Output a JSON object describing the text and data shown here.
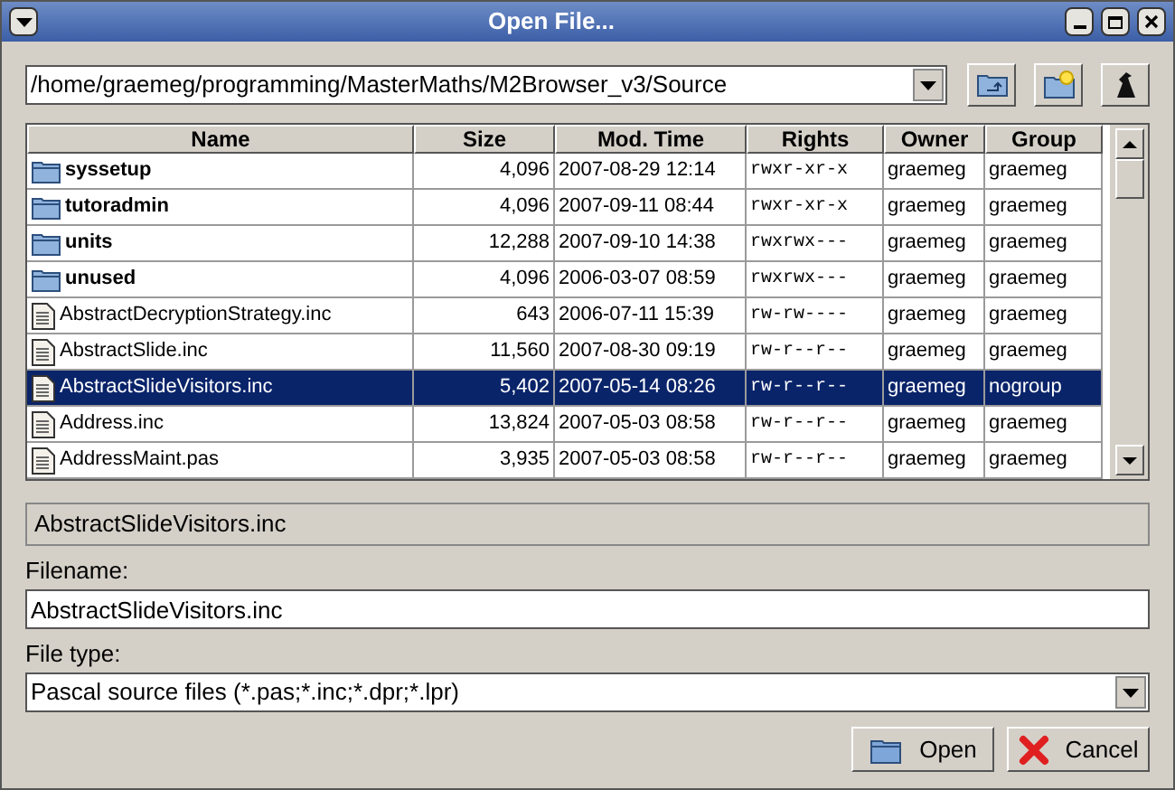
{
  "window": {
    "title": "Open File..."
  },
  "path": "/home/graemeg/programming/MasterMaths/M2Browser_v3/Source",
  "table": {
    "columns": [
      "Name",
      "Size",
      "Mod. Time",
      "Rights",
      "Owner",
      "Group"
    ],
    "rows": [
      {
        "kind": "folder",
        "selected": false,
        "cells": [
          "syssetup",
          "4,096",
          "2007-08-29 12:14",
          "rwxr-xr-x",
          "graemeg",
          "graemeg"
        ]
      },
      {
        "kind": "folder",
        "selected": false,
        "cells": [
          "tutoradmin",
          "4,096",
          "2007-09-11 08:44",
          "rwxr-xr-x",
          "graemeg",
          "graemeg"
        ]
      },
      {
        "kind": "folder",
        "selected": false,
        "cells": [
          "units",
          "12,288",
          "2007-09-10 14:38",
          "rwxrwx---",
          "graemeg",
          "graemeg"
        ]
      },
      {
        "kind": "folder",
        "selected": false,
        "cells": [
          "unused",
          "4,096",
          "2006-03-07 08:59",
          "rwxrwx---",
          "graemeg",
          "graemeg"
        ]
      },
      {
        "kind": "file",
        "selected": false,
        "cells": [
          "AbstractDecryptionStrategy.inc",
          "643",
          "2006-07-11 15:39",
          "rw-rw----",
          "graemeg",
          "graemeg"
        ]
      },
      {
        "kind": "file",
        "selected": false,
        "cells": [
          "AbstractSlide.inc",
          "11,560",
          "2007-08-30 09:19",
          "rw-r--r--",
          "graemeg",
          "graemeg"
        ]
      },
      {
        "kind": "file",
        "selected": true,
        "cells": [
          "AbstractSlideVisitors.inc",
          "5,402",
          "2007-05-14 08:26",
          "rw-r--r--",
          "graemeg",
          "nogroup"
        ]
      },
      {
        "kind": "file",
        "selected": false,
        "cells": [
          "Address.inc",
          "13,824",
          "2007-05-03 08:58",
          "rw-r--r--",
          "graemeg",
          "graemeg"
        ]
      },
      {
        "kind": "file",
        "selected": false,
        "cells": [
          "AddressMaint.pas",
          "3,935",
          "2007-05-03 08:58",
          "rw-r--r--",
          "graemeg",
          "graemeg"
        ]
      }
    ]
  },
  "status": "AbstractSlideVisitors.inc",
  "filename": {
    "label": "Filename:",
    "value": "AbstractSlideVisitors.inc"
  },
  "file_type": {
    "label": "File type:",
    "value": "Pascal source files (*.pas;*.inc;*.dpr;*.lpr)"
  },
  "buttons": [
    {
      "kind": "open",
      "label": "Open"
    },
    {
      "kind": "cancel",
      "label": "Cancel"
    }
  ]
}
